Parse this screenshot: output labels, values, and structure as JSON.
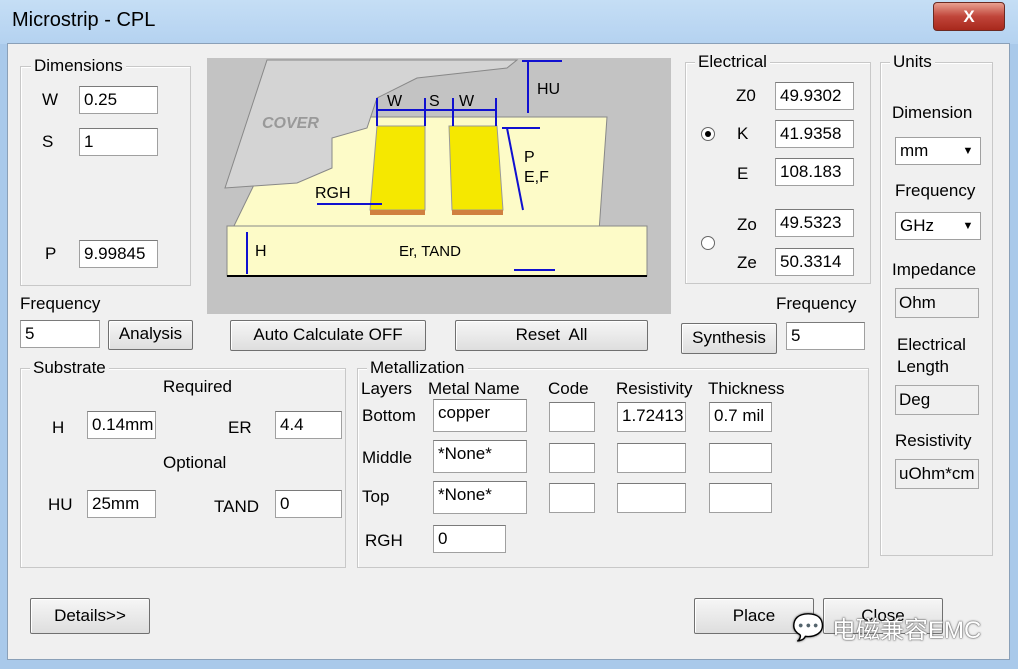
{
  "window": {
    "title": "Microstrip - CPL",
    "close_icon": "X"
  },
  "dimensions": {
    "legend": "Dimensions",
    "w_label": "W",
    "w_value": "0.25",
    "s_label": "S",
    "s_value": "1",
    "p_label": "P",
    "p_value": "9.99845"
  },
  "analysis": {
    "frequency_label": "Frequency",
    "frequency_value": "5",
    "button": "Analysis"
  },
  "diagram": {
    "cover": "COVER",
    "w": "W",
    "s": "S",
    "hu": "HU",
    "p": "P",
    "ef": "E,F",
    "rgh": "RGH",
    "h": "H",
    "er_tand": "Er, TAND"
  },
  "toolbar": {
    "auto_calc": "Auto Calculate OFF",
    "reset": "Reset  All"
  },
  "electrical": {
    "legend": "Electrical",
    "z0_label": "Z0",
    "z0_value": "49.9302",
    "k_label": "K",
    "k_value": "41.9358",
    "e_label": "E",
    "e_value": "108.183",
    "zo_label": "Zo",
    "zo_value": "49.5323",
    "ze_label": "Ze",
    "ze_value": "50.3314",
    "selected": "K"
  },
  "synthesis": {
    "frequency_label": "Frequency",
    "frequency_value": "5",
    "button": "Synthesis"
  },
  "units": {
    "legend": "Units",
    "dimension_label": "Dimension",
    "dimension_value": "mm",
    "frequency_label": "Frequency",
    "frequency_value": "GHz",
    "impedance_label": "Impedance",
    "impedance_value": "Ohm",
    "elec_length_label1": "Electrical",
    "elec_length_label2": "Length",
    "elec_length_value": "Deg",
    "resistivity_label": "Resistivity",
    "resistivity_value": "uOhm*cm"
  },
  "substrate": {
    "legend": "Substrate",
    "required": "Required",
    "optional": "Optional",
    "h_label": "H",
    "h_value": "0.14mm",
    "er_label": "ER",
    "er_value": "4.4",
    "hu_label": "HU",
    "hu_value": "25mm",
    "tand_label": "TAND",
    "tand_value": "0"
  },
  "metallization": {
    "legend": "Metallization",
    "headers": [
      "Layers",
      "Metal Name",
      "Code",
      "Resistivity",
      "Thickness"
    ],
    "rows": [
      {
        "layer": "Bottom",
        "name": "copper",
        "code": "",
        "resistivity": "1.72413",
        "thickness": "0.7 mil"
      },
      {
        "layer": "Middle",
        "name": "*None*",
        "code": "",
        "resistivity": "",
        "thickness": ""
      },
      {
        "layer": "Top",
        "name": "*None*",
        "code": "",
        "resistivity": "",
        "thickness": ""
      }
    ],
    "rgh_label": "RGH",
    "rgh_value": "0"
  },
  "buttons": {
    "details": "Details>>",
    "place": "Place",
    "close": "Close"
  },
  "watermark": "电磁兼容EMC"
}
